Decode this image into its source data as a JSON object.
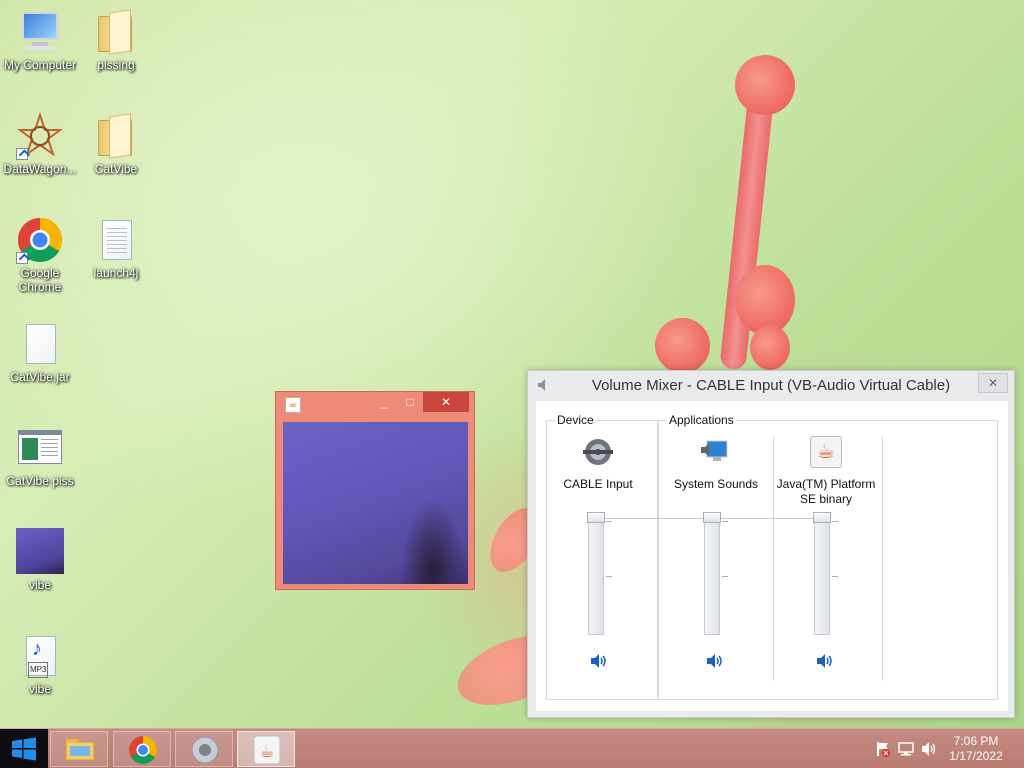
{
  "desktop": {
    "icons": [
      {
        "label": "My Computer",
        "kind": "computer-icon"
      },
      {
        "label": "pissing",
        "kind": "folder-icon"
      },
      {
        "label": "DataWagon...",
        "kind": "datawagon-icon"
      },
      {
        "label": "CatVibe",
        "kind": "folder-icon"
      },
      {
        "label": "Google Chrome",
        "kind": "chrome-icon"
      },
      {
        "label": "launch4j",
        "kind": "text-file-icon"
      },
      {
        "label": "CatVibe.jar",
        "kind": "file-icon"
      },
      {
        "label": "CatVibe piss",
        "kind": "window-file-icon"
      },
      {
        "label": "vibe",
        "kind": "video-thumbnail-icon"
      },
      {
        "label": "vibe",
        "kind": "mp3-file-icon"
      }
    ]
  },
  "java_window": {
    "buttons": {
      "minimize": "_",
      "maximize": "□",
      "close": "✕"
    },
    "app_icon": "java-icon"
  },
  "volume_mixer": {
    "title": "Volume Mixer - CABLE Input (VB-Audio Virtual Cable)",
    "close": "✕",
    "device_group": "Device",
    "applications_group": "Applications",
    "channels": [
      {
        "name": "CABLE Input",
        "icon": "cable-device-icon",
        "level": 1.0
      },
      {
        "name": "System Sounds",
        "icon": "system-sounds-icon",
        "level": 1.0
      },
      {
        "name": "Java(TM) Platform SE binary",
        "icon": "java-icon",
        "level": 1.0
      }
    ]
  },
  "taskbar": {
    "items": [
      "start-button",
      "file-explorer",
      "google-chrome",
      "volume-mixer",
      "java-app"
    ],
    "clock_time": "7:06 PM",
    "clock_date": "1/17/2022"
  },
  "colors": {
    "taskbar": "#b87c72",
    "java_window_frame": "#ef8a78",
    "accent_blue": "#1c5fc6"
  }
}
